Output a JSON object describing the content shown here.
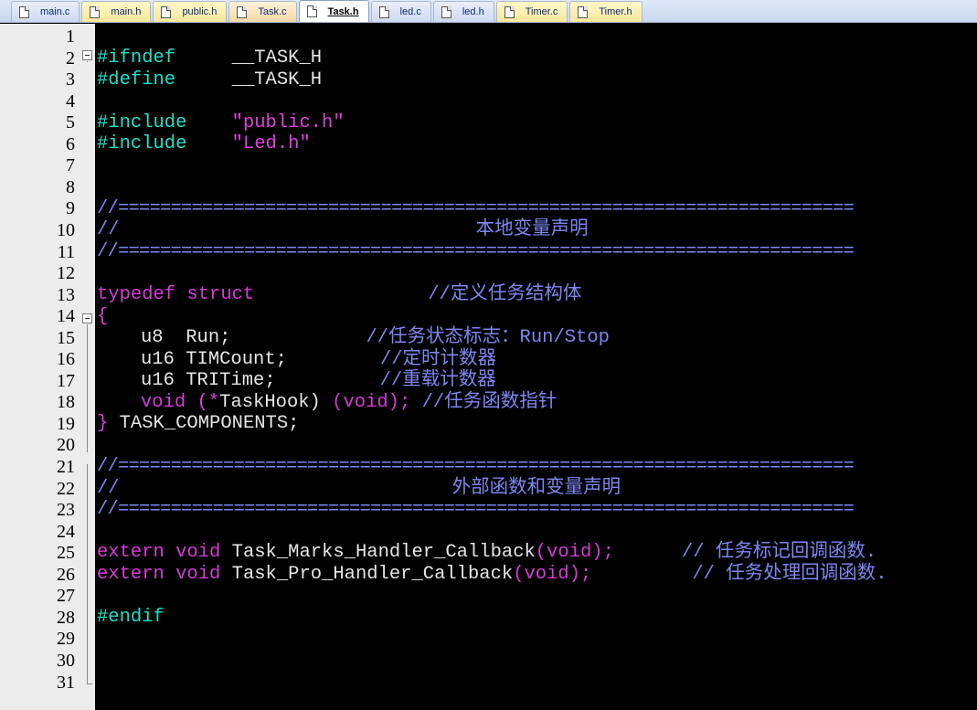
{
  "tabs": [
    {
      "label": "main.c",
      "kind": "c"
    },
    {
      "label": "main.h",
      "kind": "h"
    },
    {
      "label": "public.h",
      "kind": "h"
    },
    {
      "label": "Task.c",
      "kind": "ch"
    },
    {
      "label": "Task.h",
      "kind": "active"
    },
    {
      "label": "led.c",
      "kind": "c"
    },
    {
      "label": "led.h",
      "kind": "c"
    },
    {
      "label": "Timer.c",
      "kind": "h"
    },
    {
      "label": "Timer.h",
      "kind": "h"
    }
  ],
  "active_tab": "Task.h",
  "line_numbers": [
    "1",
    "2",
    "3",
    "4",
    "5",
    "6",
    "7",
    "8",
    "9",
    "10",
    "11",
    "12",
    "13",
    "14",
    "15",
    "16",
    "17",
    "18",
    "19",
    "20",
    "21",
    "22",
    "23",
    "24",
    "25",
    "26",
    "27",
    "28",
    "29",
    "30",
    "31"
  ],
  "code": {
    "l2_directive": "#ifndef",
    "l2_macro": "__TASK_H",
    "l3_directive": "#define",
    "l3_macro": "__TASK_H",
    "l5_directive": "#include",
    "l5_file": "\"public.h\"",
    "l6_directive": "#include",
    "l6_file": "\"Led.h\"",
    "sep_line": "//======================================================================",
    "l10_prefix": "//",
    "l10_title": "本地变量声明",
    "l13_typedef": "typedef struct",
    "l13_comment": "//定义任务结构体",
    "l14_brace": "{",
    "l15_type": "u8",
    "l15_name": "Run;",
    "l15_comment": "//任务状态标志：Run/Stop",
    "l16_type": "u16",
    "l16_name": "TIMCount;",
    "l16_comment": "//定时计数器",
    "l17_type": "u16",
    "l17_name": "TRITime;",
    "l17_comment": "//重载计数器",
    "l18_void": "void",
    "l18_open": "(*",
    "l18_name": "TaskHook)",
    "l18_args": "(void);",
    "l18_comment": "//任务函数指针",
    "l19_close": "}",
    "l19_name": "TASK_COMPONENTS;",
    "l22_prefix": "//",
    "l22_title": "外部函数和变量声明",
    "l25_kw": "extern void",
    "l25_fn": "Task_Marks_Handler_Callback",
    "l25_args": "(void);",
    "l25_comment": "// 任务标记回调函数.",
    "l26_kw": "extern void",
    "l26_fn": "Task_Pro_Handler_Callback",
    "l26_args": "(void);",
    "l26_comment": "// 任务处理回调函数.",
    "l28_directive": "#endif"
  },
  "colors": {
    "background": "#000000",
    "preprocessor": "#1fe0c8",
    "string": "#e23fe0",
    "keyword": "#d83ad8",
    "comment": "#7f86f0",
    "text": "#e6e6e6",
    "gutter": "#ececec"
  },
  "icons": {
    "tab_icon": "document-icon",
    "fold_icon": "fold-minus-icon"
  }
}
